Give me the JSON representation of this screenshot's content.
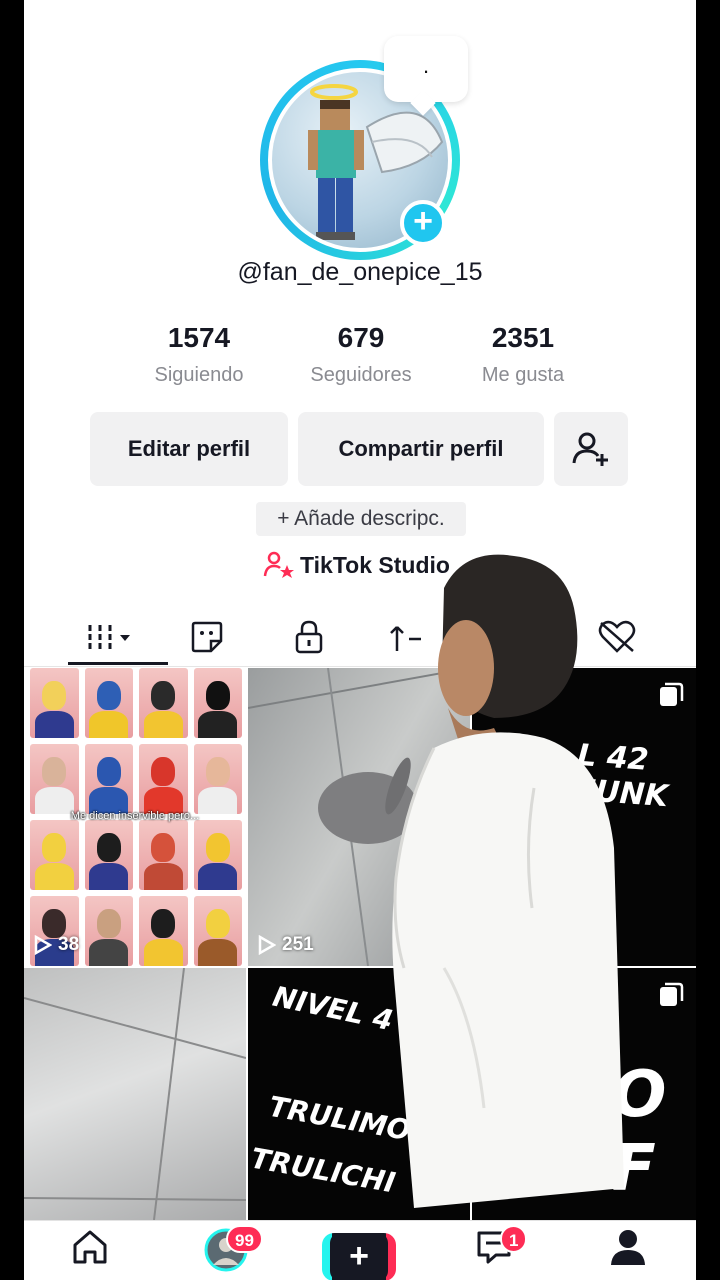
{
  "profile": {
    "username": "@fan_de_onepice_15",
    "bubble_text": ".",
    "add_description": "+ Añade descripc.",
    "studio_label": "TikTok Studio"
  },
  "stats": [
    {
      "value": "1574",
      "label": "Siguiendo"
    },
    {
      "value": "679",
      "label": "Seguidores"
    },
    {
      "value": "2351",
      "label": "Me gusta"
    }
  ],
  "buttons": {
    "edit": "Editar perfil",
    "share": "Compartir perfil"
  },
  "tabs": [
    "videos-grid-icon",
    "repost-sticker-icon",
    "lock-icon",
    "share-arrow-icon",
    "liked-hidden-icon"
  ],
  "videos": [
    {
      "views": "38",
      "caption": "Me dicen inservible pero..."
    },
    {
      "views": "251"
    },
    {
      "overlay_text": "L 42 FUNK"
    },
    {},
    {
      "overlay_lines": [
        "NIVEL 4",
        "TRULIMO",
        "TRULICHI"
      ]
    },
    {
      "overlay_text": "O F"
    }
  ],
  "nav": {
    "friends_badge": "99",
    "inbox_badge": "1"
  },
  "colors": {
    "accent_cyan": "#25f4ee",
    "accent_red": "#fe2c55",
    "text": "#161823"
  }
}
